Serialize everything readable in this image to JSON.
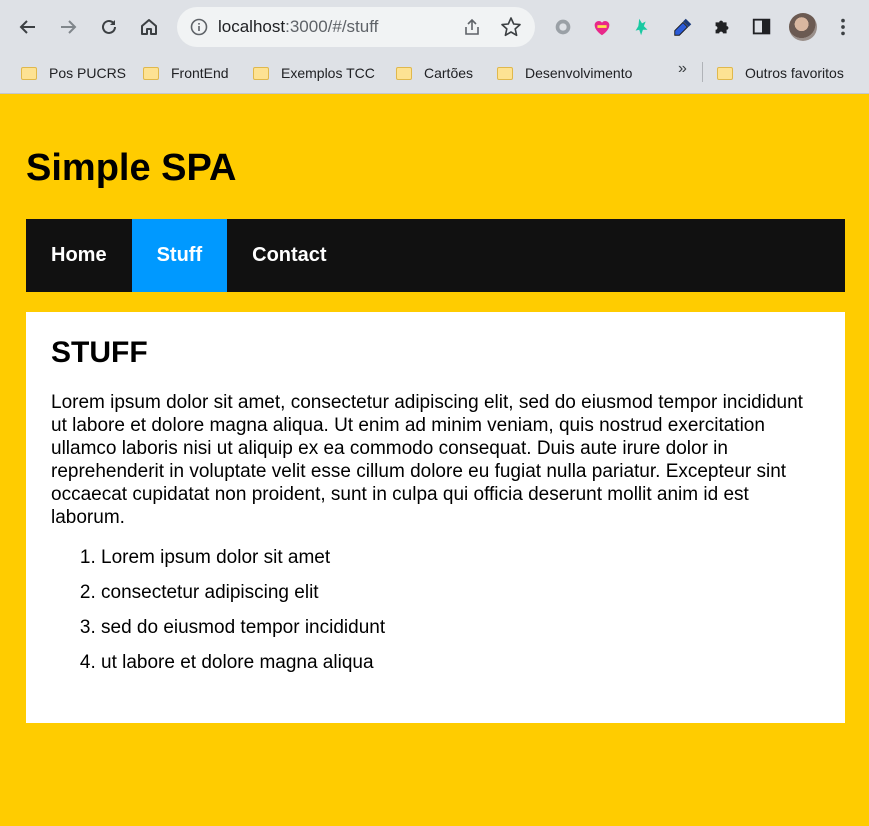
{
  "browser": {
    "url_host": "localhost",
    "url_path": ":3000/#/stuff",
    "bookmarks": [
      {
        "label": "Pos PUCRS"
      },
      {
        "label": "FrontEnd"
      },
      {
        "label": "Exemplos TCC"
      },
      {
        "label": "Cartões"
      },
      {
        "label": "Desenvolvimento"
      }
    ],
    "bookmarks_more": "»",
    "other_bookmarks": "Outros favoritos"
  },
  "site": {
    "title": "Simple SPA",
    "nav": [
      {
        "label": "Home",
        "active": false
      },
      {
        "label": "Stuff",
        "active": true
      },
      {
        "label": "Contact",
        "active": false
      }
    ],
    "active_color": "#0099ff",
    "page_bg": "#ffcc00"
  },
  "page": {
    "heading": "STUFF",
    "paragraph": "Lorem ipsum dolor sit amet, consectetur adipiscing elit, sed do eiusmod tempor incididunt ut labore et dolore magna aliqua. Ut enim ad minim veniam, quis nostrud exercitation ullamco laboris nisi ut aliquip ex ea commodo consequat. Duis aute irure dolor in reprehenderit in voluptate velit esse cillum dolore eu fugiat nulla pariatur. Excepteur sint occaecat cupidatat non proident, sunt in culpa qui officia deserunt mollit anim id est laborum.",
    "list": [
      "Lorem ipsum dolor sit amet",
      "consectetur adipiscing elit",
      "sed do eiusmod tempor incididunt",
      "ut labore et dolore magna aliqua"
    ]
  }
}
